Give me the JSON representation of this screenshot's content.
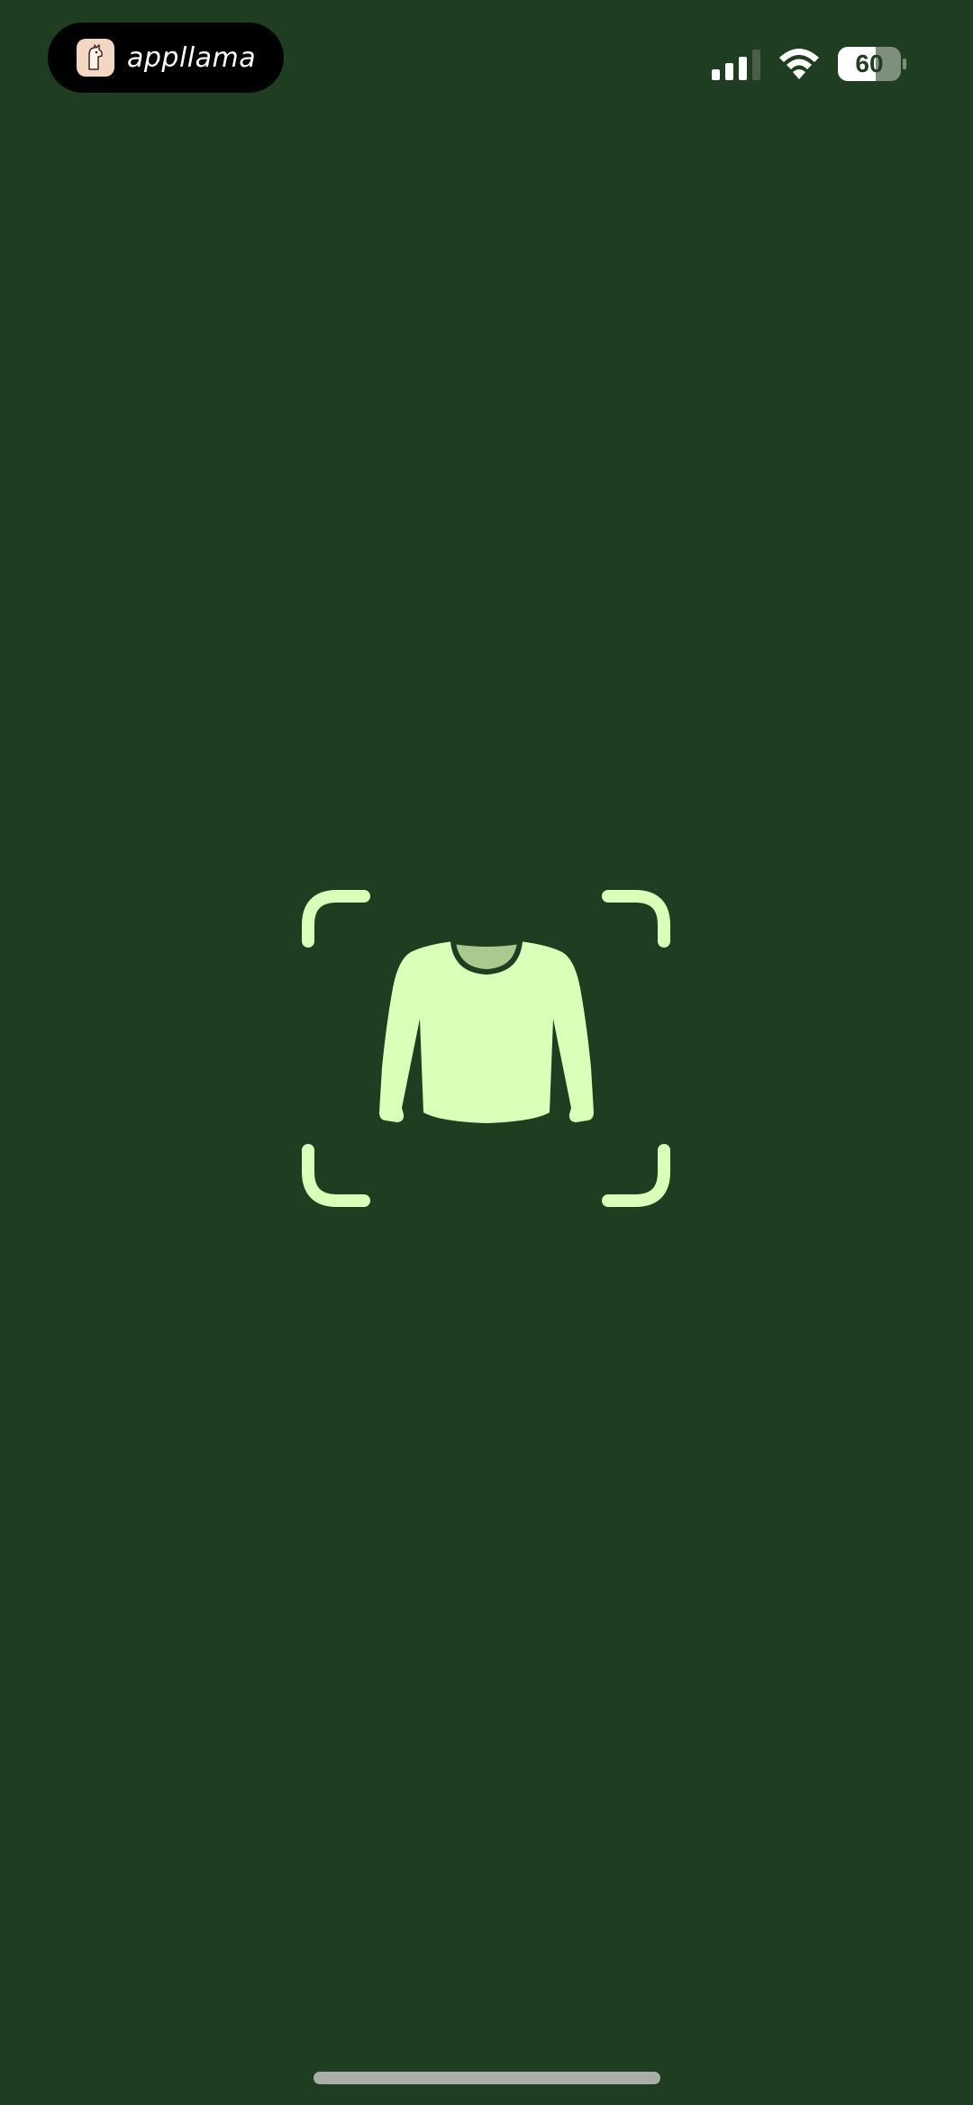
{
  "status_bar": {
    "app_pill": {
      "logo_icon": "llama-icon",
      "name": "appllama"
    },
    "signal_icon": "cellular-signal-icon",
    "wifi_icon": "wifi-icon",
    "battery": {
      "icon": "battery-icon",
      "level_text": "60",
      "level_percent": 60
    }
  },
  "main": {
    "scan_frame_icon": "viewfinder-corners-icon",
    "garment_icon": "sweater-icon"
  },
  "colors": {
    "background": "#1f3d20",
    "accent": "#daffb8",
    "neckline": "#a9c98f",
    "home_indicator": "#a9aea7"
  }
}
